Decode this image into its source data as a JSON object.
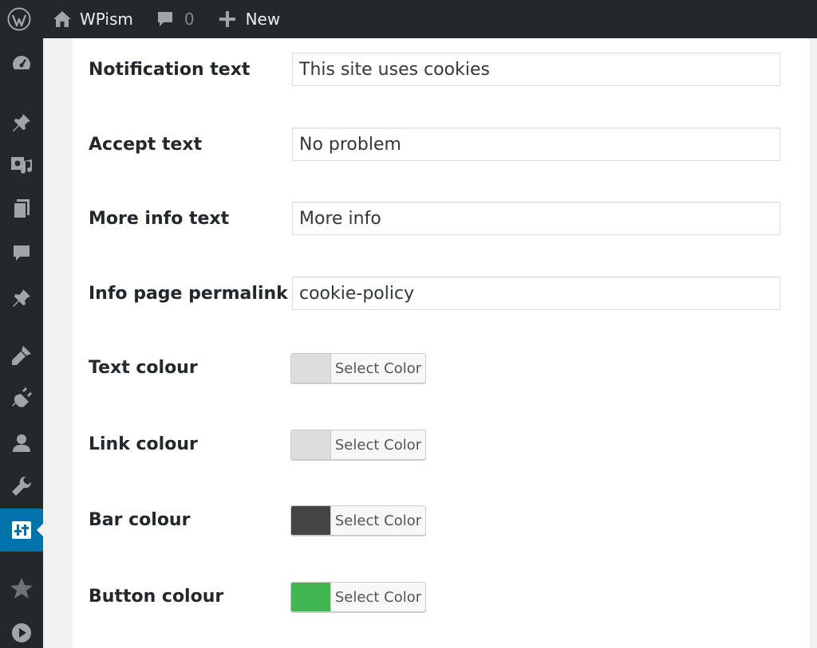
{
  "adminbar": {
    "site_name": "WPism",
    "comment_count": "0",
    "new_label": "New",
    "icons": [
      "wordpress-logo-icon",
      "home-icon",
      "comment-bubble-icon",
      "plus-icon"
    ]
  },
  "sidemenu": {
    "items": [
      {
        "icon": "dashboard-icon"
      },
      {
        "icon": "pin-icon"
      },
      {
        "icon": "media-icon"
      },
      {
        "icon": "pages-icon"
      },
      {
        "icon": "comments-icon"
      },
      {
        "icon": "pin-icon"
      },
      {
        "icon": "appearance-icon"
      },
      {
        "icon": "plugins-icon"
      },
      {
        "icon": "users-icon"
      },
      {
        "icon": "tools-icon"
      },
      {
        "icon": "settings-icon",
        "active": true
      },
      {
        "icon": "star-icon"
      },
      {
        "icon": "play-icon"
      }
    ]
  },
  "form": {
    "notification": {
      "label": "Notification text",
      "value": "This site uses cookies"
    },
    "accept": {
      "label": "Accept text",
      "value": "No problem"
    },
    "more_info": {
      "label": "More info text",
      "value": "More info"
    },
    "permalink": {
      "label": "Info page permalink",
      "value": "cookie-policy"
    },
    "text_colour": {
      "label": "Text colour",
      "button": "Select Color",
      "color": "#dddddd"
    },
    "link_colour": {
      "label": "Link colour",
      "button": "Select Color",
      "color": "#dddddd"
    },
    "bar_colour": {
      "label": "Bar colour",
      "button": "Select Color",
      "color": "#444444"
    },
    "button_colour": {
      "label": "Button colour",
      "button": "Select Color",
      "color": "#3fb64f"
    }
  },
  "colors": {
    "adminbar_bg": "#23282d",
    "accent": "#0073aa"
  }
}
